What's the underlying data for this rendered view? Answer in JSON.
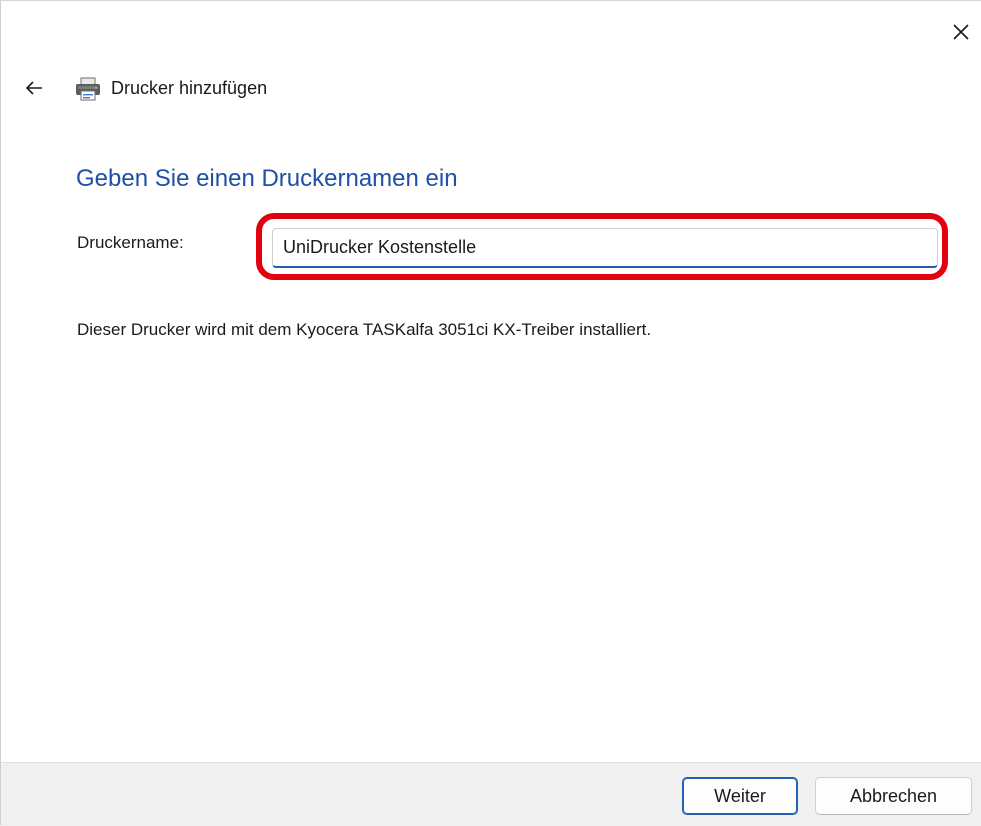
{
  "window": {
    "title": "Drucker hinzufügen"
  },
  "icons": {
    "close": "close-icon",
    "back": "arrow-left-icon",
    "printer": "printer-icon"
  },
  "main": {
    "heading": "Geben Sie einen Druckernamen ein",
    "field_label": "Druckername:",
    "field_value": "UniDrucker Kostenstelle",
    "info_text": "Dieser Drucker wird mit dem Kyocera TASKalfa 3051ci KX-Treiber installiert."
  },
  "footer": {
    "next_label": "Weiter",
    "cancel_label": "Abbrechen"
  },
  "colors": {
    "heading": "#1f4fa8",
    "accent": "#1f5fb6",
    "highlight": "#e3000f",
    "footer_bg": "#f0f0f0"
  }
}
